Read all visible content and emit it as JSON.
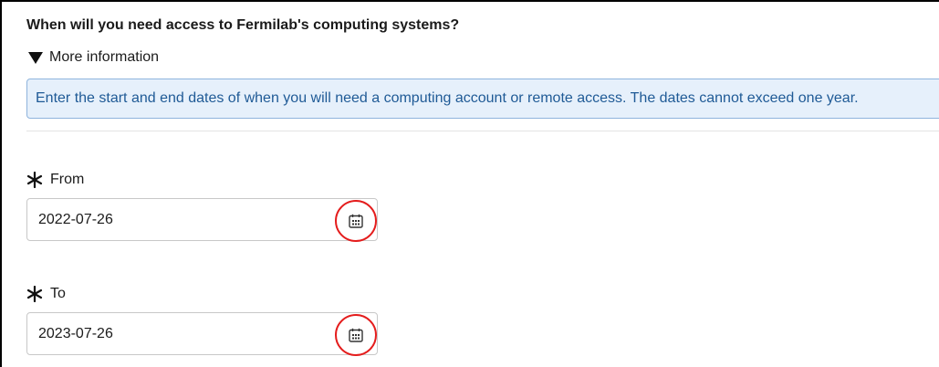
{
  "form": {
    "question": "When will you need access to Fermilab's computing systems?",
    "more_info_label": "More information",
    "info_text": "Enter the start and end dates of when you will need a computing account or remote access. The dates cannot exceed one year."
  },
  "fields": {
    "from": {
      "label": "From",
      "value": "2022-07-26",
      "required": true
    },
    "to": {
      "label": "To",
      "value": "2023-07-26",
      "required": true
    }
  },
  "icons": {
    "expand": "triangle-down-icon",
    "required": "asterisk-icon",
    "calendar": "calendar-icon"
  },
  "colors": {
    "info_background": "#e6f0fb",
    "info_border": "#8fb4dd",
    "info_text": "#1f5a96",
    "highlight": "#e41c1c"
  }
}
